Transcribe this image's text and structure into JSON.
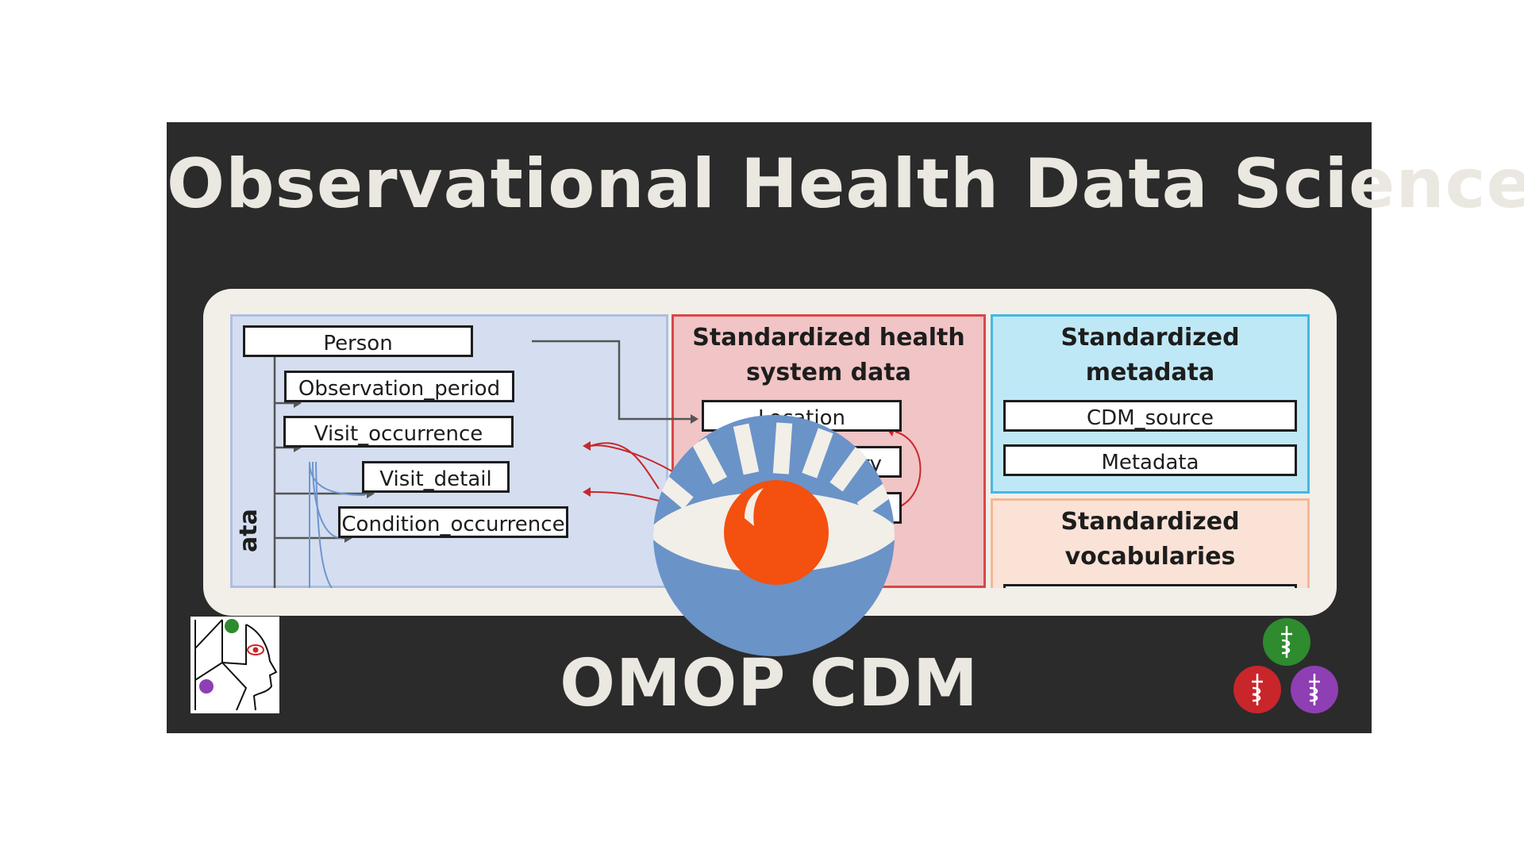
{
  "title": "Observational Health Data Science",
  "subtitle": "OMOP CDM",
  "diagram": {
    "clinical_label": "ata",
    "clinical_tables": [
      "Person",
      "Observation_period",
      "Visit_occurrence",
      "Visit_detail",
      "Condition_occurrence"
    ],
    "health_system": {
      "title_line1": "Standardized health",
      "title_line2": "system data",
      "tables": [
        "Location",
        "tory",
        ""
      ]
    },
    "metadata": {
      "title_line1": "Standardized",
      "title_line2": "metadata",
      "tables": [
        "CDM_source",
        "Metadata"
      ]
    },
    "vocabularies": {
      "title_line1": "Standardized",
      "title_line2": "vocabularies"
    }
  },
  "colors": {
    "banner": "#2b2b2b",
    "text": "#ebe8e1",
    "eye_blue": "#6a93c8",
    "eye_orange": "#f4500f",
    "green": "#2e8b2e",
    "red": "#c8262a",
    "purple": "#8e3fb3"
  },
  "icons": [
    "eye-logo-icon",
    "head-profile-logo-icon",
    "caduceus-icon"
  ]
}
